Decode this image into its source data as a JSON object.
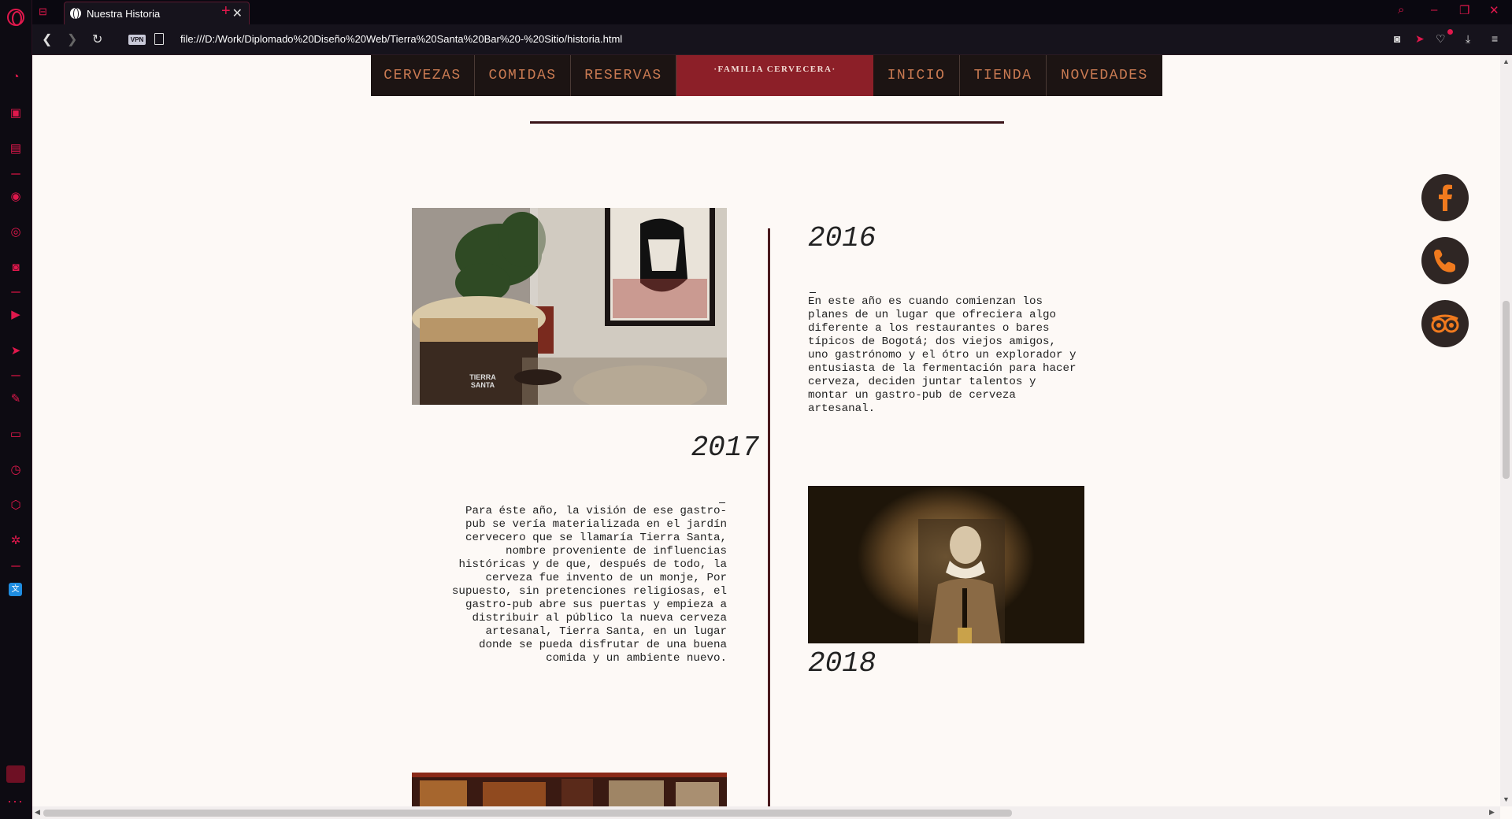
{
  "browser": {
    "tab_title": "Nuestra Historia",
    "tab_close": "✕",
    "new_tab": "+",
    "vpn_label": "VPN",
    "url": "file:///D:/Work/Diplomado%20Diseño%20Web/Tierra%20Santa%20Bar%20-%20Sitio/historia.html",
    "accent_color": "#e0184c"
  },
  "site_nav": {
    "items_left": [
      "CERVEZAS",
      "COMIDAS",
      "RESERVAS"
    ],
    "logo_text": "·FAMILIA CERVECERA·",
    "items_right": [
      "INICIO",
      "TIENDA",
      "NOVEDADES"
    ],
    "text_color": "#c97a52",
    "logo_bg": "#8c1f28"
  },
  "timeline": {
    "entries": [
      {
        "year": "2016",
        "text": "En este año es cuando comienzan los\nplanes de un lugar que ofreciera algo\ndiferente a los restaurantes o bares\ntípicos de Bogotá; dos viejos amigos,\nuno gastrónomo y el ótro un explorador y\nentusiasta de la fermentación para hacer\ncerveza, deciden juntar talentos y\nmontar un gastro-pub de cerveza\nartesanal."
      },
      {
        "year": "2017",
        "text": "Para éste año, la visión de ese gastro-\npub se vería materializada en el jardín\ncervecero que se llamaría Tierra Santa,\nnombre proveniente de influencias\nhistóricas y de que, después de todo, la\ncerveza fue invento de un monje, Por\nsupuesto, sin pretenciones religiosas, el\ngastro-pub abre sus puertas y empieza a\ndistribuir al público la nueva cerveza\nartesanal, Tierra Santa, en un lugar\ndonde se pueda disfrutar de una buena\ncomida y un ambiente nuevo."
      },
      {
        "year": "2018"
      }
    ],
    "photo_labels": {
      "barrel_brand": "TIERRA SANTA"
    }
  },
  "social": {
    "icons": [
      "facebook-icon",
      "phone-icon",
      "tripadvisor-icon"
    ],
    "icon_color": "#f07a1e"
  }
}
